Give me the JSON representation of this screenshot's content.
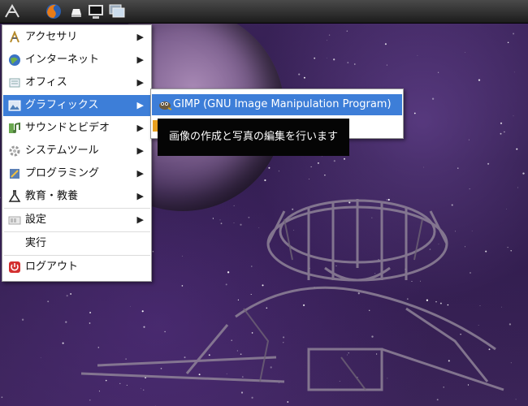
{
  "panel": {
    "icons": [
      "lxde-menu-icon",
      "firefox-icon",
      "file-manager-icon",
      "terminal-icon",
      "desktop-switch-icon"
    ]
  },
  "menu": {
    "items": [
      {
        "label": "アクセサリ",
        "icon": "accessories-icon",
        "submenu": true
      },
      {
        "label": "インターネット",
        "icon": "internet-globe-icon",
        "submenu": true
      },
      {
        "label": "オフィス",
        "icon": "office-icon",
        "submenu": true
      },
      {
        "label": "グラフィックス",
        "icon": "graphics-icon",
        "submenu": true,
        "selected": true
      },
      {
        "label": "サウンドとビデオ",
        "icon": "sound-video-icon",
        "submenu": true
      },
      {
        "label": "システムツール",
        "icon": "system-tools-icon",
        "submenu": true
      },
      {
        "label": "プログラミング",
        "icon": "programming-icon",
        "submenu": true
      },
      {
        "label": "教育・教養",
        "icon": "education-flask-icon",
        "submenu": true
      },
      {
        "label": "設定",
        "icon": "settings-icon",
        "submenu": true
      },
      {
        "label": "実行",
        "icon": "",
        "submenu": false
      },
      {
        "label": "ログアウト",
        "icon": "logout-icon",
        "submenu": false
      }
    ]
  },
  "submenu": {
    "item_label": "GIMP (GNU Image Manipulation Program)",
    "item_icon": "gimp-icon"
  },
  "tooltip": {
    "text": "画像の作成と写真の編集を行います"
  },
  "colors": {
    "selection": "#3d7ed8",
    "panel": "#2a2a2a",
    "tooltip_bg": "#050505"
  }
}
